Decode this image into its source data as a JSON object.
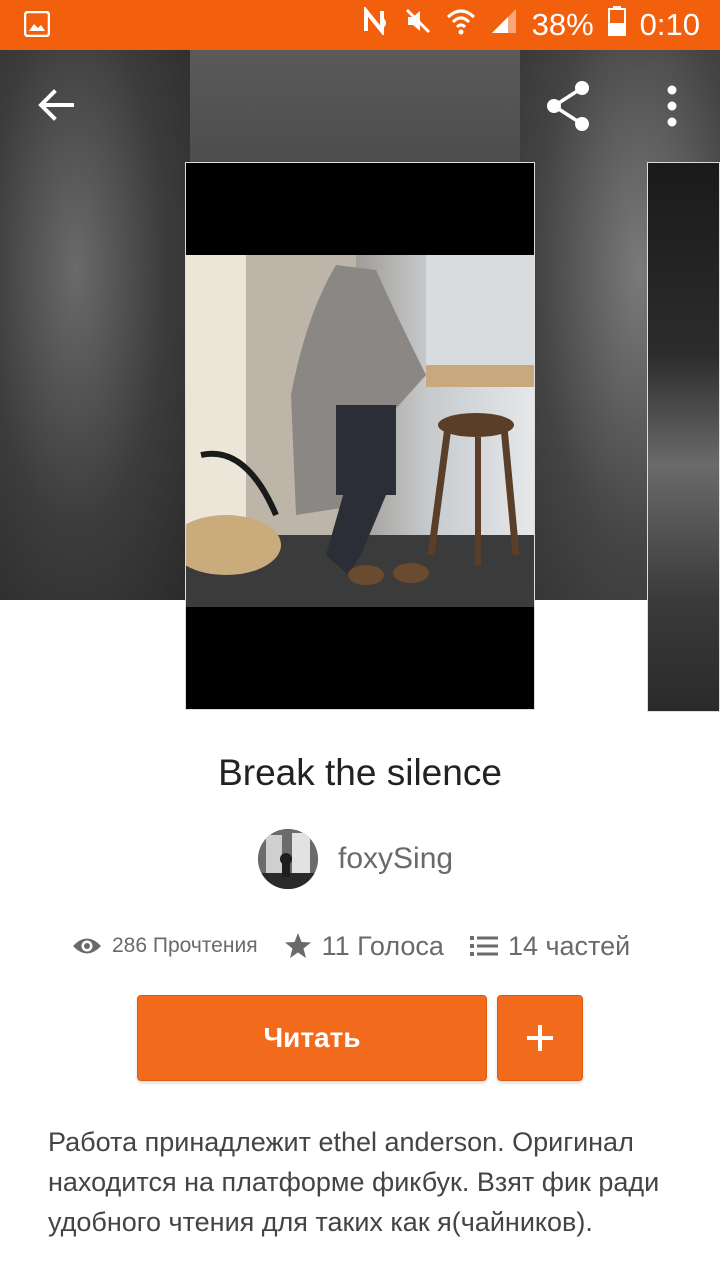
{
  "status_bar": {
    "battery": "38%",
    "time": "0:10",
    "icons": [
      "gallery-icon",
      "nfc-icon",
      "mute-icon",
      "wifi-icon",
      "signal-icon",
      "battery-icon"
    ]
  },
  "toolbar": {
    "back_icon": "arrow-back-icon",
    "share_icon": "share-icon",
    "more_icon": "more-vert-icon"
  },
  "story": {
    "title": "Break the silence",
    "author": "foxySing",
    "stats": {
      "reads": "286 Прочтения",
      "votes": "11 Голоса",
      "parts": "14 частей"
    },
    "read_button": "Читать",
    "add_button": "+",
    "description": "Работа принадлежит ethel anderson. Оригинал находится на платформе фикбук. Взят фик ради удобного чтения для таких как я(чайников)."
  },
  "colors": {
    "accent": "#f26a1b",
    "status_bar": "#f2600e",
    "secondary_text": "#6a6a6a"
  }
}
